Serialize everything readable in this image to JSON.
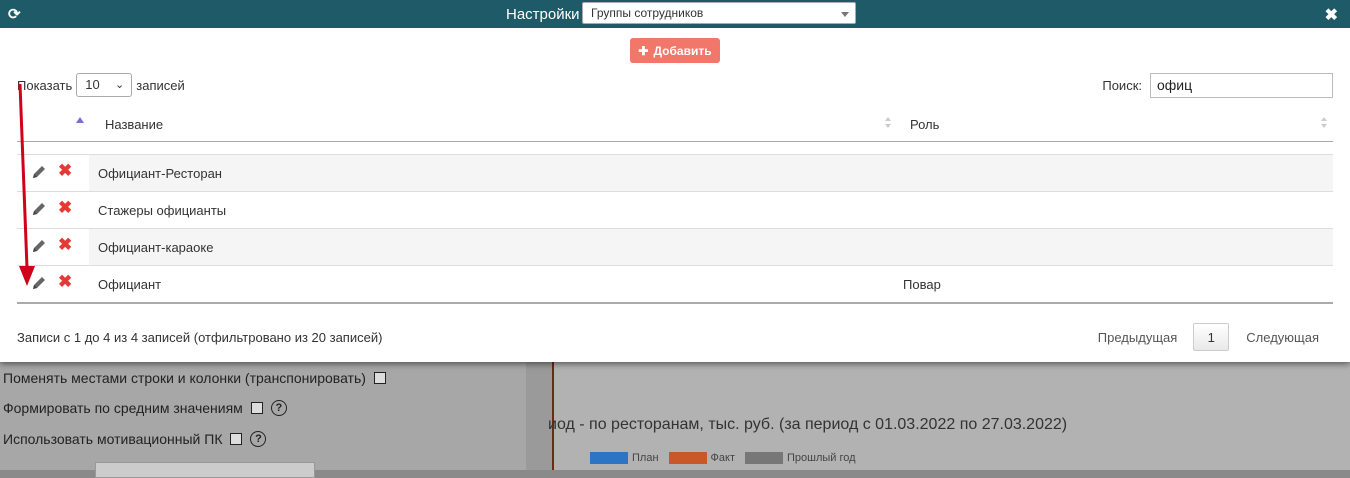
{
  "background": {
    "rows": [
      {
        "label": "Поменять местами строки и колонки (транспонировать)",
        "help": false
      },
      {
        "label": "Формировать по средним значениям",
        "help": true
      },
      {
        "label": "Использовать мотивационный ПК",
        "help": true
      }
    ],
    "help_glyph": "?",
    "chart_title": "иод - по ресторанам, тыс. руб. (за период с 01.03.2022 по 27.03.2022)",
    "legend": [
      {
        "label": "План",
        "color": "#2d74c4"
      },
      {
        "label": "Факт",
        "color": "#c8572a"
      },
      {
        "label": "Прошлый год",
        "color": "#777777"
      }
    ]
  },
  "modal": {
    "title": "Настройки",
    "selector_value": "Группы сотрудников",
    "add_label": "Добавить",
    "show_prefix": "Показать",
    "show_value": "10",
    "show_suffix": "записей",
    "search_label": "Поиск:",
    "search_value": "офиц",
    "columns": {
      "name": "Название",
      "role": "Роль"
    },
    "rows": [
      {
        "name": "Официант-Ресторан",
        "role": ""
      },
      {
        "name": "Стажеры официанты",
        "role": ""
      },
      {
        "name": "Официант-караоке",
        "role": ""
      },
      {
        "name": "Официант",
        "role": "Повар"
      }
    ],
    "info": "Записи с 1 до 4 из 4 записей (отфильтровано из 20 записей)",
    "pager": {
      "prev": "Предыдущая",
      "page": "1",
      "next": "Следующая"
    }
  },
  "colors": {
    "titlebar": "#1e5a67",
    "add_button": "#f0776a",
    "delete": "#e53935",
    "annotation_arrow": "#d0021b"
  }
}
